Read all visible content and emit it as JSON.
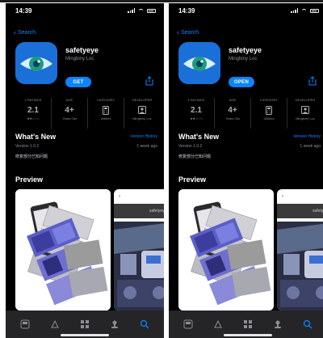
{
  "phones": [
    {
      "status_time": "14:39",
      "back_label": "Search",
      "app_name": "safetyeye",
      "developer": "Mingbiny Loc",
      "action_label": "GET",
      "stats": [
        {
          "label": "1 RATINGS",
          "value": "2.1",
          "sub": "★★☆☆☆"
        },
        {
          "label": "AGE",
          "value": "4+",
          "sub": "Years Old"
        },
        {
          "label": "CATEGORY",
          "value": "",
          "sub": "Utilities"
        },
        {
          "label": "DEVELOPER",
          "value": "",
          "sub": "Mingbiny Loc"
        }
      ],
      "whats_new": {
        "title": "What's New",
        "history_link": "Version History",
        "version": "Version 1.0.2",
        "ago": "1 week ago",
        "notes": "修复部分已知问题"
      },
      "preview_title": "Preview",
      "shot2_banner": "safetyeye"
    },
    {
      "status_time": "14:39",
      "back_label": "Search",
      "app_name": "safetyeye",
      "developer": "Mingbiny Loc",
      "action_label": "OPEN",
      "stats": [
        {
          "label": "1 RATINGS",
          "value": "2.1",
          "sub": "★★☆☆☆"
        },
        {
          "label": "AGE",
          "value": "4+",
          "sub": "Years Old"
        },
        {
          "label": "CATEGORY",
          "value": "",
          "sub": "Utilities"
        },
        {
          "label": "DEVELOPER",
          "value": "",
          "sub": "Mingbiny Loc"
        }
      ],
      "whats_new": {
        "title": "What's New",
        "history_link": "Version History",
        "version": "Version 1.0.2",
        "ago": "1 week ago",
        "notes": "修复部分已知问题"
      },
      "preview_title": "Preview",
      "shot2_banner": "safetyeye"
    }
  ],
  "tabbar": [
    "today-icon",
    "games-icon",
    "apps-icon",
    "arcade-icon",
    "search-icon"
  ],
  "colors": {
    "accent": "#0a84ff",
    "icon_bg": "#1a6fd8",
    "background": "#000000"
  }
}
